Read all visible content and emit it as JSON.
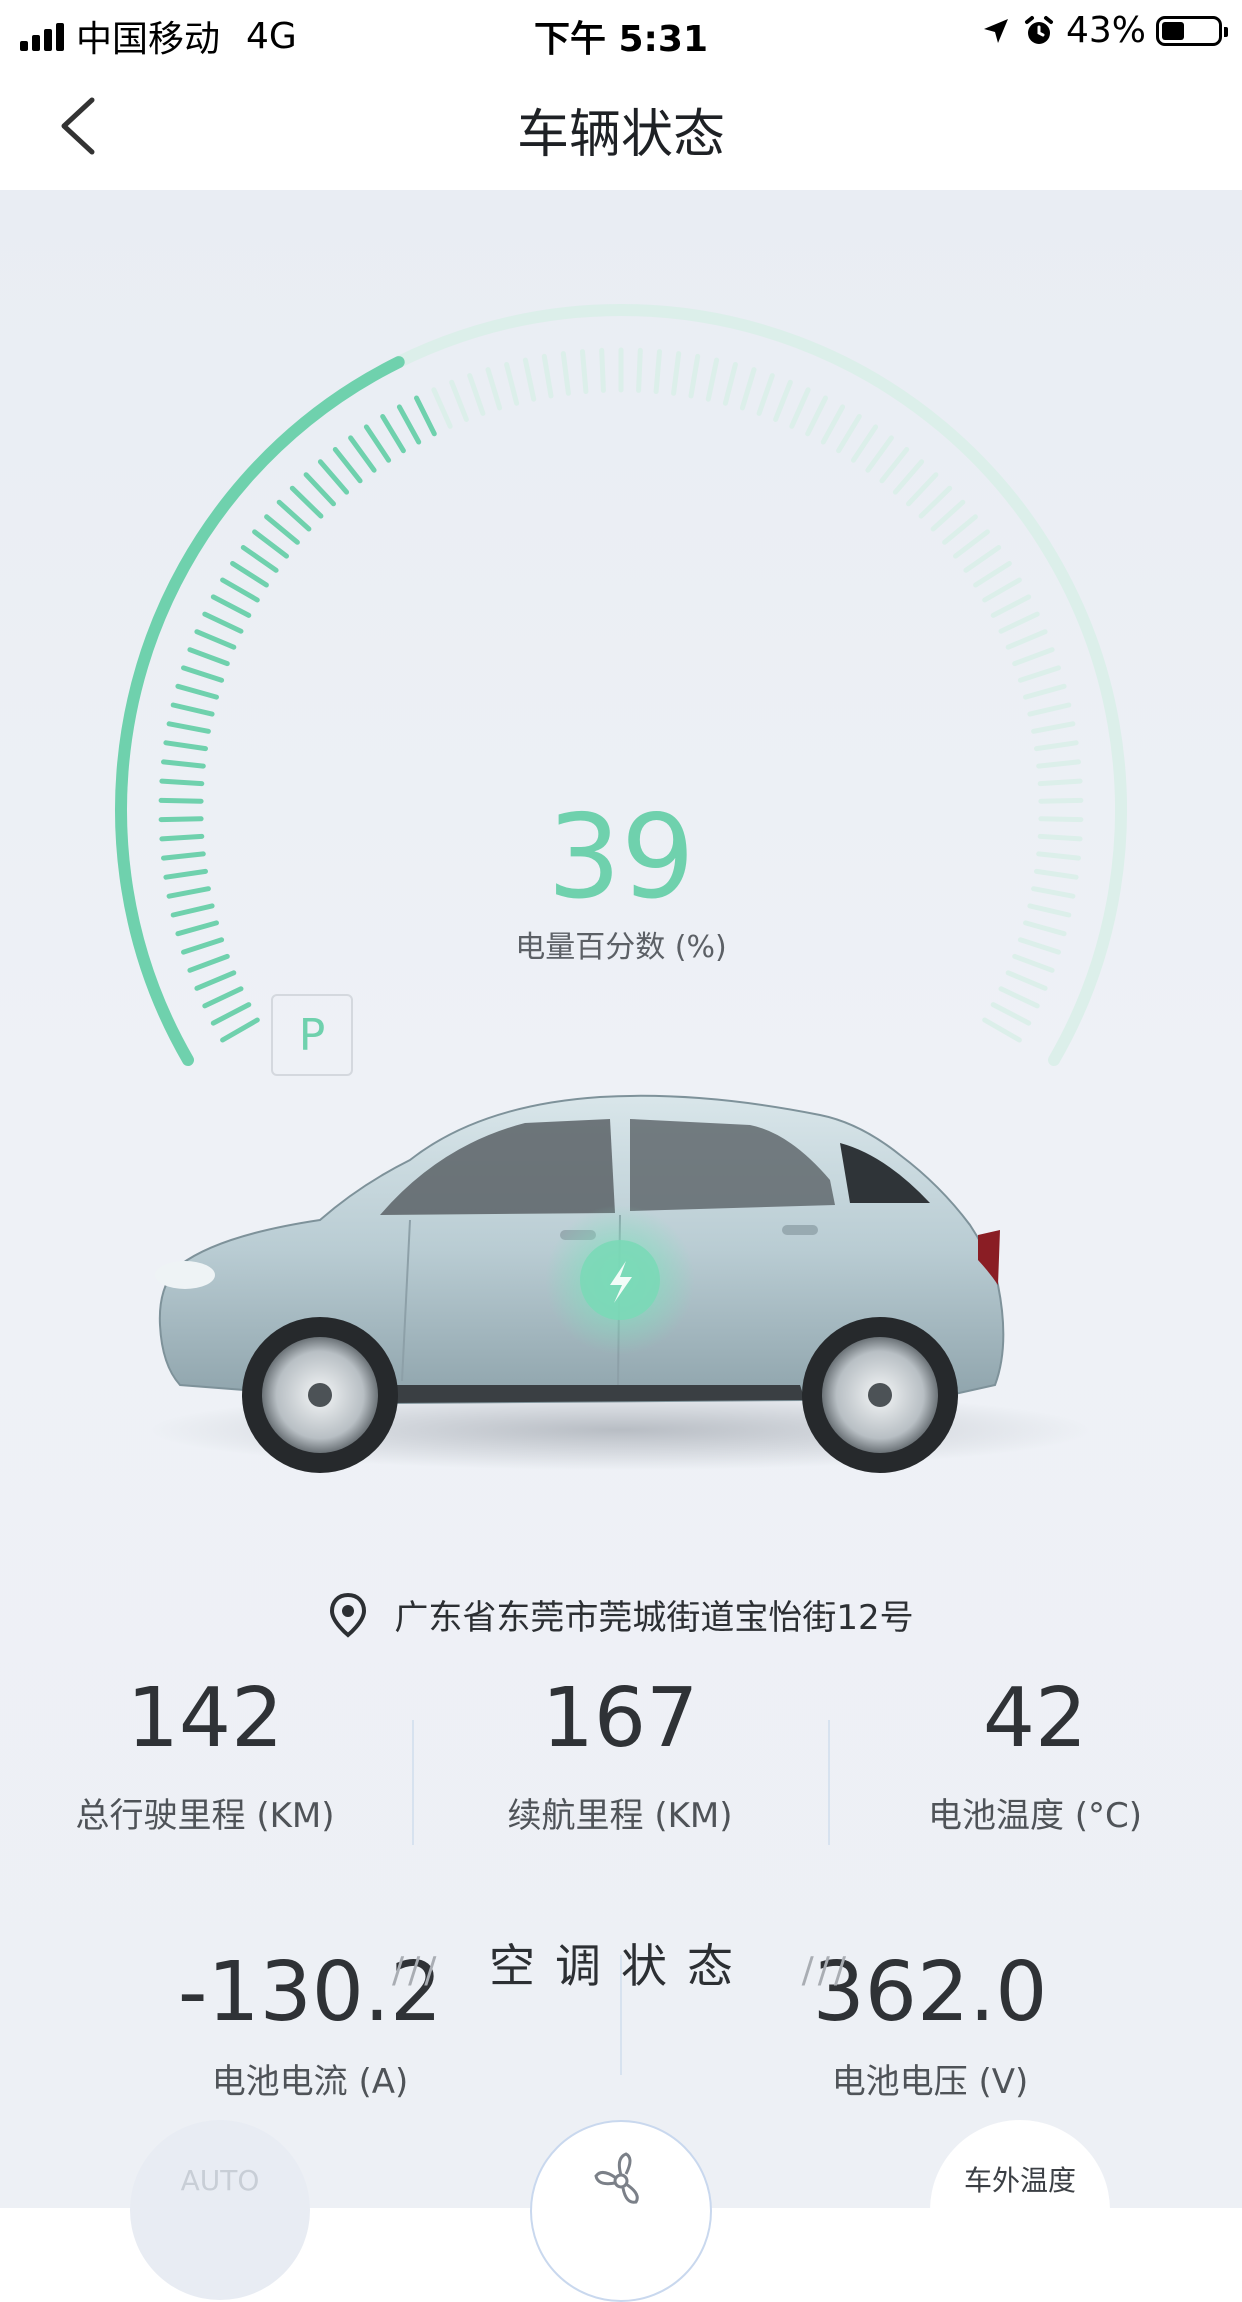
{
  "status_bar": {
    "carrier": "中国移动",
    "network": "4G",
    "time": "下午 5:31",
    "battery_percent": "43%"
  },
  "nav": {
    "title": "车辆状态"
  },
  "gauge": {
    "value": "39",
    "label": "电量百分数 (%)",
    "level_fraction": 0.39,
    "accent_color": "#6fd1ad",
    "track_color": "#dcefea"
  },
  "gear": "P",
  "location": {
    "address": "广东省东莞市莞城街道宝怡街12号"
  },
  "stats_row1": [
    {
      "value": "142",
      "label": "总行驶里程 (KM)"
    },
    {
      "value": "167",
      "label": "续航里程 (KM)"
    },
    {
      "value": "42",
      "label": "电池温度 (°C)"
    }
  ],
  "stats_row2": [
    {
      "value": "-130.2",
      "label": "电池电流 (A)"
    },
    {
      "value": "362.0",
      "label": "电池电压 (V)"
    }
  ],
  "ac_section": {
    "title": "空调状态",
    "slash_left": "///",
    "slash_right": "///"
  },
  "ac_buttons": {
    "auto_label": "AUTO",
    "outside_temp_label": "车外温度"
  }
}
